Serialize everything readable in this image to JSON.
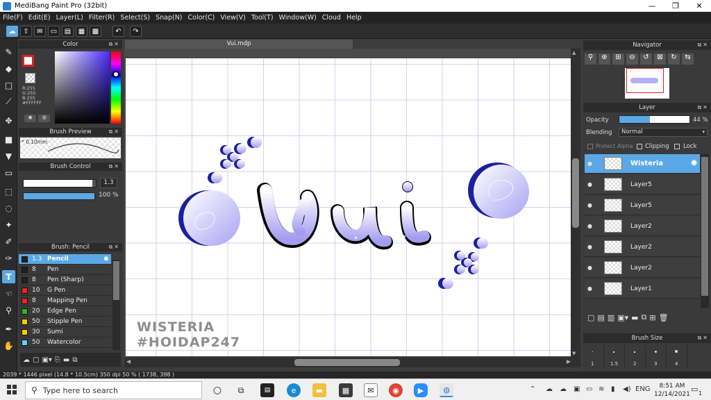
{
  "window": {
    "title": "MediBang Paint Pro (32bit)",
    "minimize": "—",
    "maximize": "❐",
    "close": "✕"
  },
  "menu": [
    "File(F)",
    "Edit(E)",
    "Layer(L)",
    "Filter(R)",
    "Select(S)",
    "Snap(N)",
    "Color(C)",
    "View(V)",
    "Tool(T)",
    "Window(W)",
    "Cloud",
    "Help"
  ],
  "panels": {
    "color": {
      "title": "Color",
      "r": "R:255",
      "g": "G:255",
      "b": "B:255",
      "hex": "#FFFFFF"
    },
    "brush_preview": {
      "title": "Brush Preview",
      "size": "* 0.10mm"
    },
    "brush_control": {
      "title": "Brush Control",
      "size": "1.3",
      "opacity": "100 %",
      "size_level": 0.95,
      "opacity_level": 1.0
    },
    "brush_list": {
      "title": "Brush: Pencil",
      "items": [
        {
          "size": "1.3",
          "name": "Pencil",
          "color": "#222222",
          "active": true
        },
        {
          "size": "8",
          "name": "Pen",
          "color": "#222222"
        },
        {
          "size": "8",
          "name": "Pen (Sharp)",
          "color": "#222222"
        },
        {
          "size": "10",
          "name": "G Pen",
          "color": "#ee2222"
        },
        {
          "size": "8",
          "name": "Mapping Pen",
          "color": "#ee2222"
        },
        {
          "size": "20",
          "name": "Edge Pen",
          "color": "#22bb22"
        },
        {
          "size": "50",
          "name": "Stipple Pen",
          "color": "#f0d000"
        },
        {
          "size": "30",
          "name": "Sumi",
          "color": "#f0d000"
        },
        {
          "size": "50",
          "name": "Watercolor",
          "color": "#66ccff"
        }
      ]
    },
    "navigator": {
      "title": "Navigator"
    },
    "layer": {
      "title": "Layer",
      "opacity_label": "Opacity",
      "opacity_value": "44 %",
      "opacity_level": 0.44,
      "blending_label": "Blending",
      "blending_value": "Normal",
      "protect_alpha": "Protect Alpha",
      "clipping": "Clipping",
      "lock": "Lock",
      "layers": [
        {
          "name": "Wisteria",
          "active": true
        },
        {
          "name": "Layer5"
        },
        {
          "name": "Layer5"
        },
        {
          "name": "Layer2"
        },
        {
          "name": "Layer2"
        },
        {
          "name": "Layer2"
        },
        {
          "name": "Layer1"
        }
      ]
    },
    "brush_size": {
      "title": "Brush Size",
      "sizes": [
        "1",
        "1.5",
        "2",
        "3",
        "4"
      ]
    }
  },
  "document": {
    "tab": "Vui.mdp",
    "watermark_line1": "WISTERIA",
    "watermark_line2": "#HOIDAP247"
  },
  "status": "2039 * 1446 pixel  (14.8 * 10.5cm)  350 dpi  50 %  ( 1738, 398 )",
  "taskbar": {
    "search_placeholder": "Type here to search",
    "language": "ENG",
    "time": "8:51 AM",
    "date": "12/14/2021",
    "notification_count": "1"
  },
  "colors": {
    "accent": "#5aa9e6",
    "canvas_grid": "#d3d0f2",
    "art_gradient_top": "#ffffff",
    "art_gradient_bottom": "#a59cf0",
    "art_shadow": "#1b1fa0"
  }
}
